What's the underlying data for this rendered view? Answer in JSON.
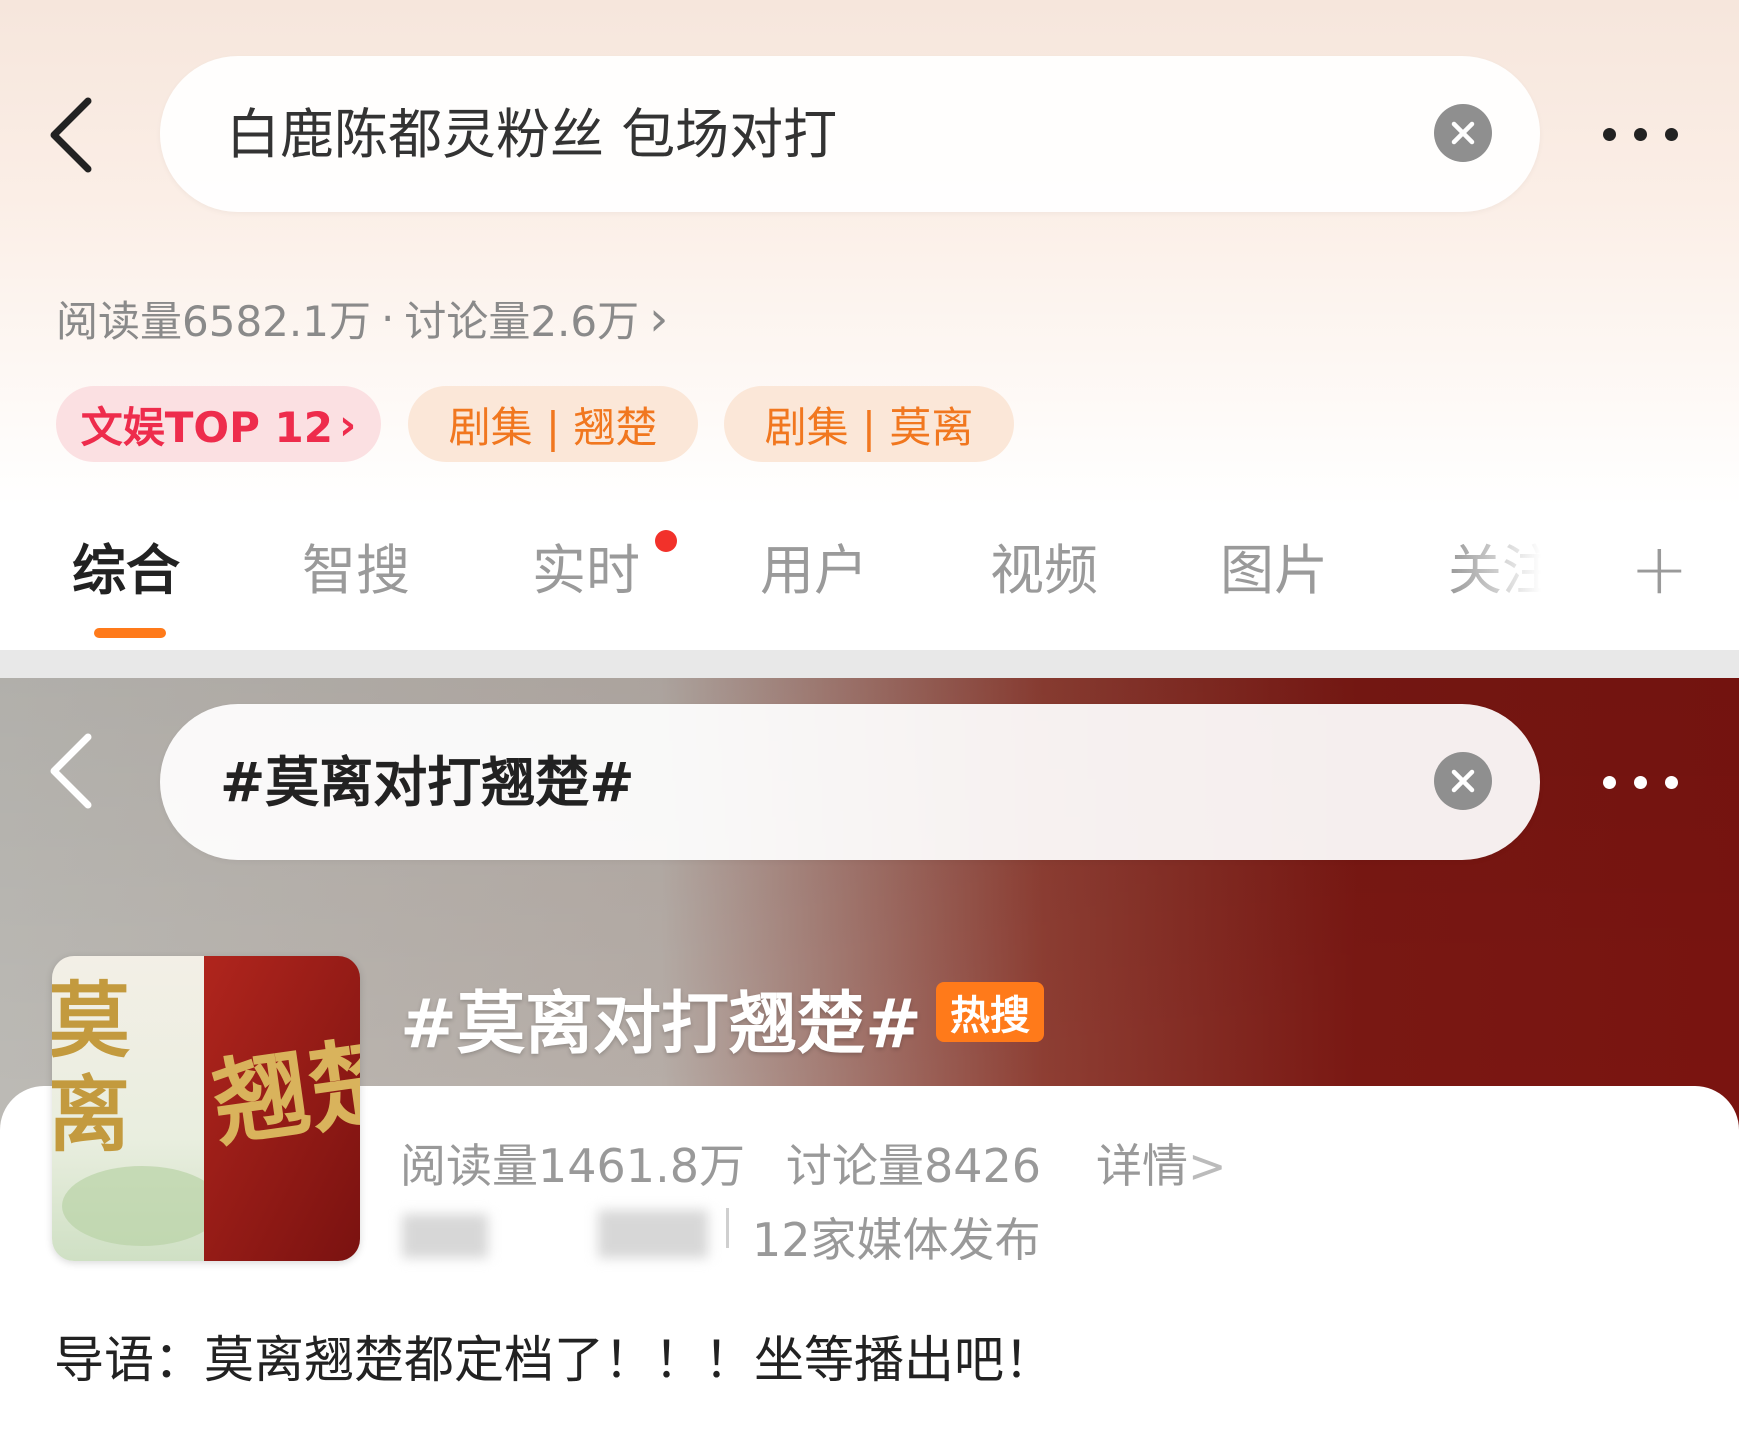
{
  "top": {
    "search": {
      "query": "白鹿陈都灵粉丝 包场对打"
    },
    "stats": {
      "reads": "阅读量6582.1万",
      "separator": "·",
      "discussion": "讨论量2.6万",
      "chevron": "›"
    },
    "chips": [
      {
        "label": "文娱TOP 12",
        "chevron": "›"
      },
      {
        "label": "剧集 | 翘楚"
      },
      {
        "label": "剧集 | 莫离"
      }
    ],
    "tabs": [
      {
        "label": "综合"
      },
      {
        "label": "智搜"
      },
      {
        "label": "实时"
      },
      {
        "label": "用户"
      },
      {
        "label": "视频"
      },
      {
        "label": "图片"
      },
      {
        "label": "关注"
      }
    ],
    "add_tab": "+"
  },
  "bottom": {
    "search": {
      "query": "#莫离对打翘楚#"
    },
    "topic": {
      "title": "#莫离对打翘楚#",
      "badge": "热搜",
      "reads": "阅读量1461.8万",
      "discussion": "讨论量8426",
      "details": "详情",
      "details_chevron": ">",
      "media": "12家媒体发布",
      "cover_text_left": "莫离",
      "cover_text_right": "翘楚"
    },
    "lead": "导语：莫离翘楚都定档了！！！坐等播出吧！"
  },
  "colors": {
    "accent_orange": "#ff7a1a",
    "rank_red": "#ee2c4c",
    "category_orange": "#f1771f",
    "live_dot_red": "#f2312a",
    "banner_dark_red": "#7a1410"
  },
  "icons": [
    "back-arrow-icon",
    "clear-icon",
    "more-icon",
    "plus-icon",
    "chevron-right-icon"
  ]
}
